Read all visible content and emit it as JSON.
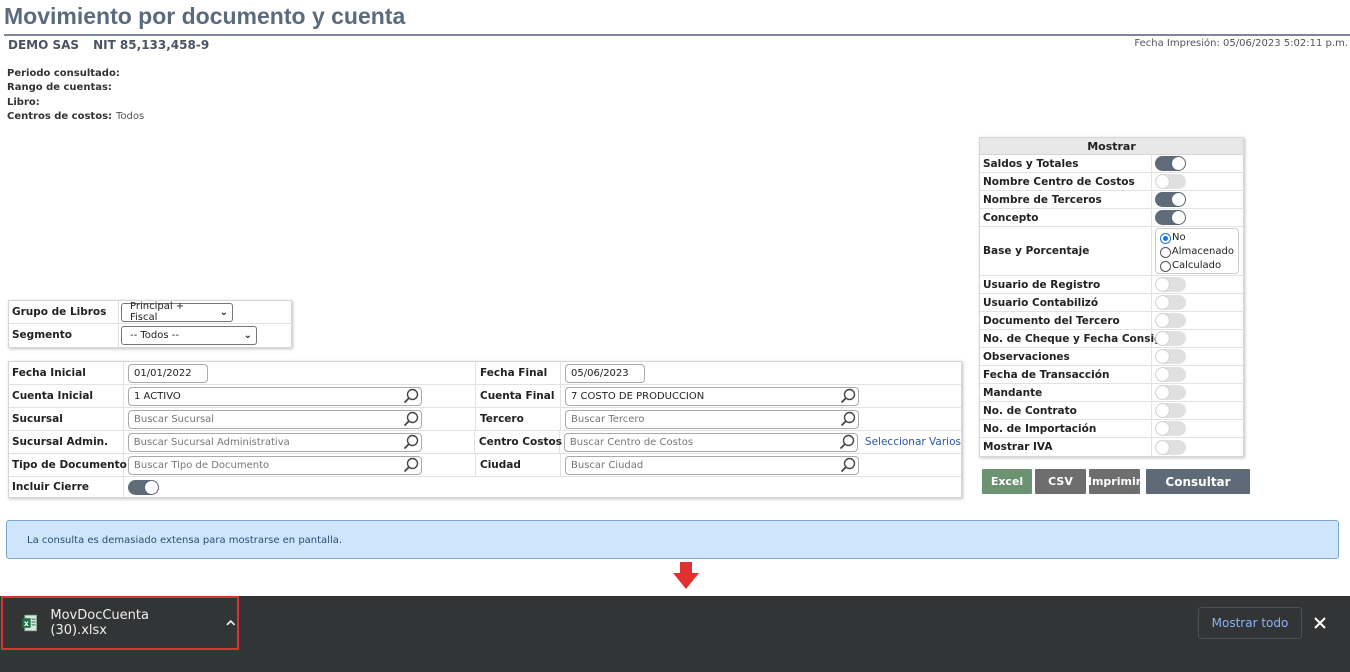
{
  "header": {
    "title": "Movimiento por documento y cuenta",
    "company": "DEMO SAS",
    "nit": "NIT 85,133,458-9",
    "fecha_impresion": "Fecha Impresión: 05/06/2023 5:02:11 p.m."
  },
  "info": {
    "periodo_label": "Periodo consultado:",
    "rango_label": "Rango de cuentas:",
    "libro_label": "Libro:",
    "centros_label": "Centros de costos:",
    "centros_value": "Todos"
  },
  "mostrar": {
    "title": "Mostrar",
    "options": [
      {
        "label": "Saldos y Totales",
        "on": true
      },
      {
        "label": "Nombre Centro de Costos",
        "on": false
      },
      {
        "label": "Nombre de Terceros",
        "on": true
      },
      {
        "label": "Concepto",
        "on": true
      },
      {
        "label": "Base y Porcentaje",
        "radios": [
          "No",
          "Almacenado",
          "Calculado"
        ],
        "selected": "No"
      },
      {
        "label": "Usuario de Registro",
        "on": false
      },
      {
        "label": "Usuario Contabilizó",
        "on": false
      },
      {
        "label": "Documento del Tercero",
        "on": false
      },
      {
        "label": "No. de Cheque y Fecha Consig.",
        "on": false
      },
      {
        "label": "Observaciones",
        "on": false
      },
      {
        "label": "Fecha de Transacción",
        "on": false
      },
      {
        "label": "Mandante",
        "on": false
      },
      {
        "label": "No. de Contrato",
        "on": false
      },
      {
        "label": "No. de Importación",
        "on": false
      },
      {
        "label": "Mostrar IVA",
        "on": false
      }
    ]
  },
  "libros": {
    "grupo_label": "Grupo de Libros",
    "grupo_value": "Principal + Fiscal",
    "segmento_label": "Segmento",
    "segmento_value": "-- Todos --"
  },
  "filters": {
    "fecha_inicial_label": "Fecha Inicial",
    "fecha_inicial_value": "01/01/2022",
    "fecha_final_label": "Fecha Final",
    "fecha_final_value": "05/06/2023",
    "cuenta_inicial_label": "Cuenta Inicial",
    "cuenta_inicial_value": "1 ACTIVO",
    "cuenta_final_label": "Cuenta Final",
    "cuenta_final_value": "7 COSTO DE PRODUCCION",
    "sucursal_label": "Sucursal",
    "sucursal_placeholder": "Buscar Sucursal",
    "tercero_label": "Tercero",
    "tercero_placeholder": "Buscar Tercero",
    "sucursal_admin_label": "Sucursal Admin.",
    "sucursal_admin_placeholder": "Buscar Sucursal Administrativa",
    "centro_costos_label": "Centro Costos",
    "centro_costos_placeholder": "Buscar Centro de Costos",
    "seleccionar_varios": "Seleccionar Varios",
    "tipo_doc_label": "Tipo de Documento",
    "tipo_doc_placeholder": "Buscar Tipo de Documento",
    "ciudad_label": "Ciudad",
    "ciudad_placeholder": "Buscar Ciudad",
    "incluir_cierre_label": "Incluir Cierre",
    "incluir_cierre_on": true
  },
  "buttons": {
    "excel": "Excel",
    "csv": "CSV",
    "imprimir": "Imprimir",
    "consultar": "Consultar"
  },
  "alert": {
    "message": "La consulta es demasiado extensa para mostrarse en pantalla."
  },
  "download_bar": {
    "file_name": "MovDocCuenta (30).xlsx",
    "mostrar_todo": "Mostrar todo",
    "file_icon": "excel-file-icon"
  },
  "colors": {
    "title": "#5b6b7e",
    "toggle_on": "#5f6b78",
    "excel_button": "#6b9271",
    "consultar_button": "#5e6a78",
    "alert_bg": "#cfe5fb",
    "arrow": "#e03030",
    "download_bar": "#333435",
    "link": "#8ab4f8"
  }
}
